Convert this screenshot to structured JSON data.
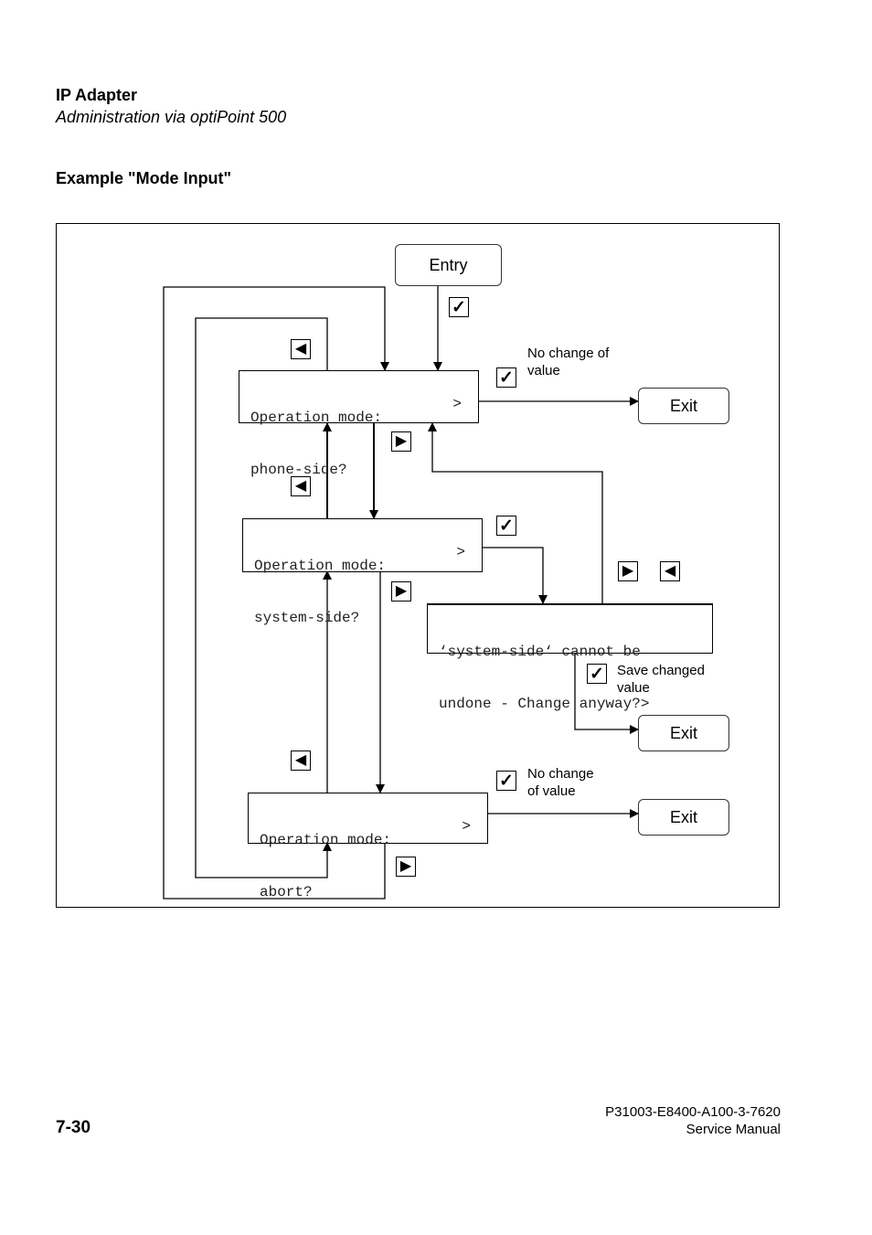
{
  "header": {
    "title": "IP Adapter",
    "subtitle": "Administration via optiPoint 500"
  },
  "section": {
    "title": "Example \"Mode Input\""
  },
  "diagram": {
    "entry": {
      "label": "Entry"
    },
    "screens": {
      "phone_side": {
        "line1": "Operation mode:",
        "line2": "phone-side?",
        "indicator": ">"
      },
      "system_side": {
        "line1": "Operation mode:",
        "line2": "system-side?",
        "indicator": ">"
      },
      "confirm": {
        "line1": "‘system-side‘ cannot be",
        "line2": "undone - Change anyway?>"
      },
      "abort": {
        "line1": "Operation mode:",
        "line2": "abort?",
        "indicator": ">"
      }
    },
    "exits": [
      {
        "label": "Exit"
      },
      {
        "label": "Exit"
      },
      {
        "label": "Exit"
      }
    ],
    "keys": {
      "check": "✓",
      "left": "◀",
      "right": "▶"
    },
    "notes": {
      "phone_exit": "No change of value",
      "save": "Save changed value",
      "abort_exit": "No change of value"
    },
    "notes_lines": {
      "phone_exit": [
        "No change of",
        "value"
      ],
      "save": [
        "Save changed",
        "value"
      ],
      "abort_exit": [
        "No change",
        "of value"
      ]
    }
  },
  "footer": {
    "page_number": "7-30",
    "doc_number": "P31003-E8400-A100-3-7620",
    "doc_type": "Service Manual"
  }
}
